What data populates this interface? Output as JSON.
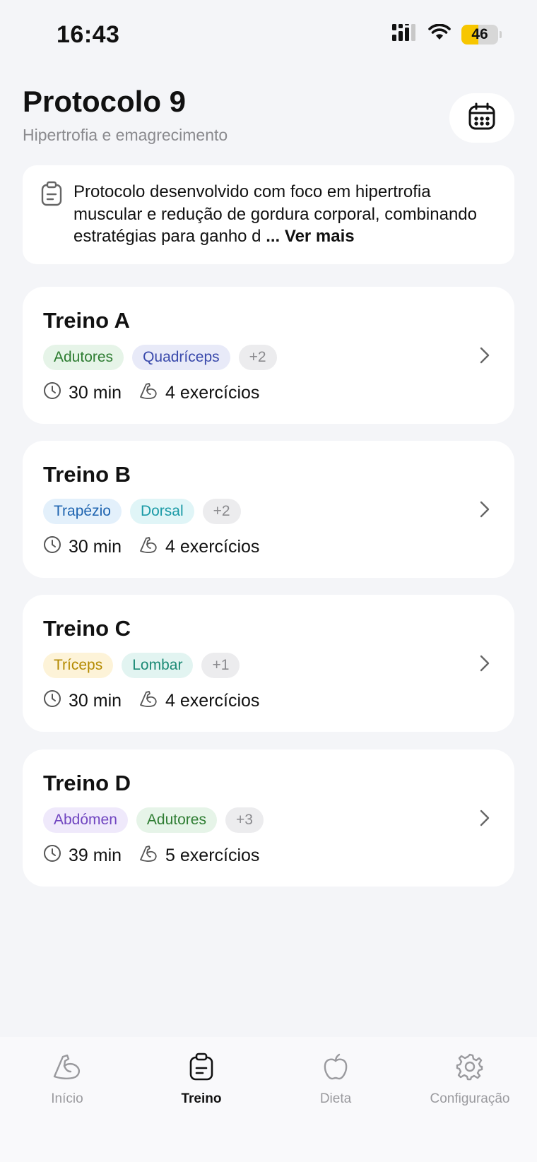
{
  "status_bar": {
    "time": "16:43",
    "battery": "46",
    "battery_level": 0.46,
    "battery_color": "#f7c600"
  },
  "header": {
    "title": "Protocolo 9",
    "subtitle": "Hipertrofia e emagrecimento",
    "calendar_icon": "calendar-icon"
  },
  "description": {
    "icon": "clipboard-icon",
    "text": "Protocolo desenvolvido com foco em hipertrofia muscular e redução de gordura corporal, combinando estratégias para ganho d",
    "ellipsis": "...",
    "more_label": "Ver mais"
  },
  "workouts": [
    {
      "title": "Treino A",
      "tags": [
        {
          "label": "Adutores",
          "bg": "#e6f4e8",
          "fg": "#2e7d32"
        },
        {
          "label": "Quadríceps",
          "bg": "#e8eaf8",
          "fg": "#3949ab"
        }
      ],
      "extra": "+2",
      "duration": "30 min",
      "exercises": "4 exercícios"
    },
    {
      "title": "Treino B",
      "tags": [
        {
          "label": "Trapézio",
          "bg": "#e3f0fb",
          "fg": "#1e64b0"
        },
        {
          "label": "Dorsal",
          "bg": "#e0f5f7",
          "fg": "#1a9aa6"
        }
      ],
      "extra": "+2",
      "duration": "30 min",
      "exercises": "4 exercícios"
    },
    {
      "title": "Treino C",
      "tags": [
        {
          "label": "Tríceps",
          "bg": "#fdf3d8",
          "fg": "#b48a00"
        },
        {
          "label": "Lombar",
          "bg": "#e2f4f1",
          "fg": "#1b8a75"
        }
      ],
      "extra": "+1",
      "duration": "30 min",
      "exercises": "4 exercícios"
    },
    {
      "title": "Treino D",
      "tags": [
        {
          "label": "Abdómen",
          "bg": "#efe9fb",
          "fg": "#7045c0"
        },
        {
          "label": "Adutores",
          "bg": "#e6f4e8",
          "fg": "#2e7d32"
        }
      ],
      "extra": "+3",
      "duration": "39 min",
      "exercises": "5 exercícios"
    }
  ],
  "extra_tag_colors": {
    "bg": "#ececee",
    "fg": "#8a8a8e"
  },
  "tab_bar": {
    "items": [
      {
        "label": "Início",
        "icon": "bicep-icon",
        "active": false
      },
      {
        "label": "Treino",
        "icon": "clipboard-icon",
        "active": true
      },
      {
        "label": "Dieta",
        "icon": "apple-icon",
        "active": false
      },
      {
        "label": "Configuração",
        "icon": "gear-icon",
        "active": false
      }
    ]
  }
}
